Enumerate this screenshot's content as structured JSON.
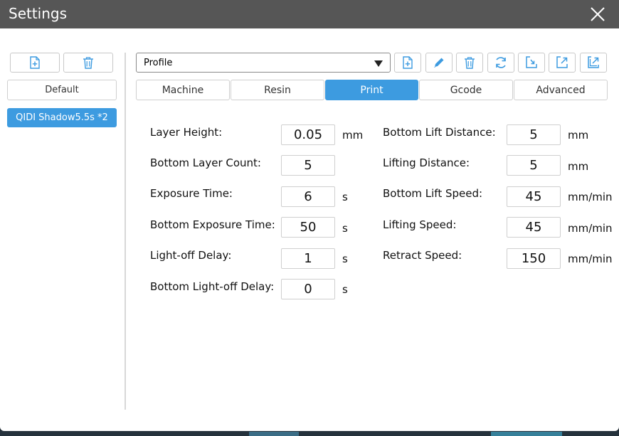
{
  "window": {
    "title": "Settings"
  },
  "left_panel": {
    "default_label": "Default",
    "selected_profile": "QIDI Shadow5.5s *2"
  },
  "toolbar": {
    "profile_select": "Profile"
  },
  "tabs": [
    {
      "label": "Machine",
      "active": false
    },
    {
      "label": "Resin",
      "active": false
    },
    {
      "label": "Print",
      "active": true
    },
    {
      "label": "Gcode",
      "active": false
    },
    {
      "label": "Advanced",
      "active": false
    }
  ],
  "print_settings": {
    "left": [
      {
        "label": "Layer Height:",
        "value": "0.05",
        "unit": "mm"
      },
      {
        "label": "Bottom Layer Count:",
        "value": "5",
        "unit": ""
      },
      {
        "label": "Exposure Time:",
        "value": "6",
        "unit": "s"
      },
      {
        "label": "Bottom Exposure Time:",
        "value": "50",
        "unit": "s"
      },
      {
        "label": "Light-off Delay:",
        "value": "1",
        "unit": "s"
      },
      {
        "label": "Bottom Light-off Delay:",
        "value": "0",
        "unit": "s"
      }
    ],
    "right": [
      {
        "label": "Bottom Lift Distance:",
        "value": "5",
        "unit": "mm"
      },
      {
        "label": "Lifting Distance:",
        "value": "5",
        "unit": "mm"
      },
      {
        "label": "Bottom Lift Speed:",
        "value": "45",
        "unit": "mm/min"
      },
      {
        "label": "Lifting Speed:",
        "value": "45",
        "unit": "mm/min"
      },
      {
        "label": "Retract Speed:",
        "value": "150",
        "unit": "mm/min"
      }
    ]
  },
  "colors": {
    "accent": "#3d9be0",
    "titlebar": "#565656"
  }
}
